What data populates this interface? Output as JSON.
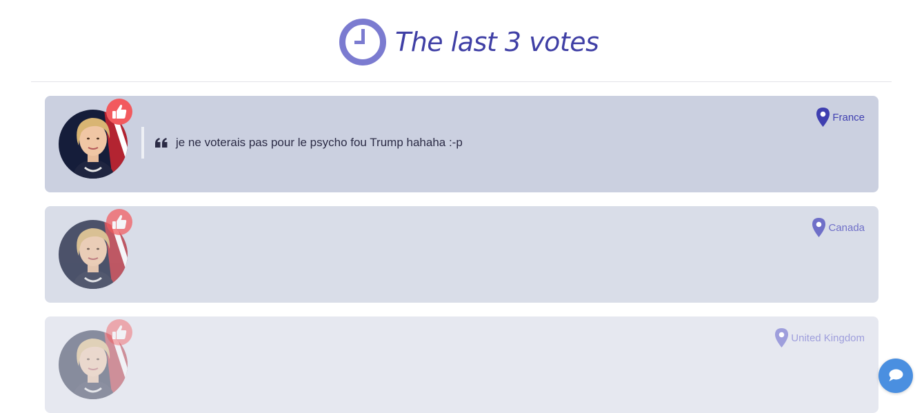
{
  "header": {
    "title": "The last 3 votes",
    "icon": "clock-icon",
    "accent_color": "#7b7bd0",
    "title_color": "#3f3fa5"
  },
  "votes": [
    {
      "comment": "je ne voterais pas pour le psycho fou Trump hahaha :-p",
      "location": "France",
      "vote_icon": "thumbs-up-icon",
      "avatar": "candidate-avatar"
    },
    {
      "comment": "",
      "location": "Canada",
      "vote_icon": "thumbs-up-icon",
      "avatar": "candidate-avatar"
    },
    {
      "comment": "",
      "location": "United Kingdom",
      "vote_icon": "thumbs-up-icon",
      "avatar": "candidate-avatar"
    }
  ],
  "chat": {
    "icon": "chat-bubble-icon",
    "color": "#4a8fe0"
  },
  "colors": {
    "like_badge": "#f25a5e",
    "card_backgrounds": [
      "#cbd0e0",
      "#d9dde8",
      "#e6e8f0"
    ]
  }
}
